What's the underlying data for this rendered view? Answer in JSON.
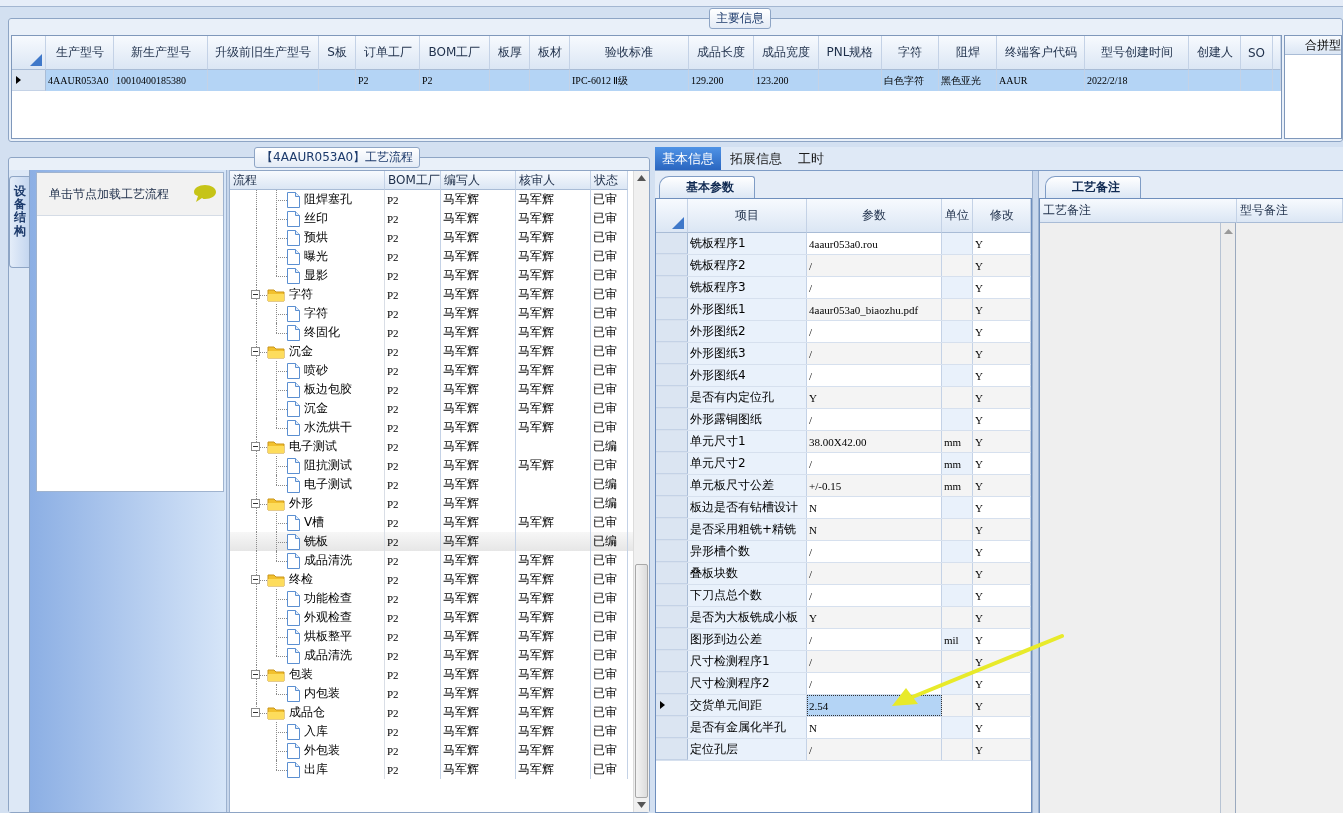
{
  "main_info": {
    "title": "主要信息",
    "columns": [
      "生产型号",
      "新生产型号",
      "升级前旧生产型号",
      "S板",
      "订单工厂",
      "BOM工厂",
      "板厚",
      "板材",
      "验收标准",
      "成品长度",
      "成品宽度",
      "PNL规格",
      "字符",
      "阻焊",
      "终端客户代码",
      "型号创建时间",
      "创建人",
      "SO"
    ],
    "rows": [
      {
        "selected": true,
        "cells": [
          "4AAUR053A0",
          "10010400185380",
          null,
          null,
          "P2",
          "P2",
          null,
          null,
          "IPC-6012 Ⅱ级",
          "129.200",
          "123.200",
          null,
          "白色字符",
          "黑色亚光",
          "AAUR",
          "2022/2/18",
          null,
          null
        ]
      }
    ],
    "side_header": "合拼型"
  },
  "process": {
    "title": "【4AAUR053A0】工艺流程",
    "side_tab": "设备结构",
    "hint": "单击节点加载工艺流程",
    "columns": [
      "流程",
      "BOM工厂",
      "编写人",
      "核审人",
      "状态"
    ],
    "tree": [
      {
        "children": [
          {
            "label": "阻焊塞孔",
            "bom": "P2",
            "writer": "马军辉",
            "reviewer": "马军辉",
            "status": "已审",
            "selected": false
          },
          {
            "label": "丝印",
            "bom": "P2",
            "writer": "马军辉",
            "reviewer": "马军辉",
            "status": "已审",
            "selected": false
          },
          {
            "label": "预烘",
            "bom": "P2",
            "writer": "马军辉",
            "reviewer": "马军辉",
            "status": "已审",
            "selected": false
          },
          {
            "label": "曝光",
            "bom": "P2",
            "writer": "马军辉",
            "reviewer": "马军辉",
            "status": "已审",
            "selected": false
          },
          {
            "label": "显影",
            "bom": "P2",
            "writer": "马军辉",
            "reviewer": "马军辉",
            "status": "已审",
            "selected": false
          }
        ]
      },
      {
        "label": "字符",
        "bom": "P2",
        "writer": "马军辉",
        "reviewer": "马军辉",
        "status": "已审",
        "selected": false,
        "expanded": true,
        "children": [
          {
            "label": "字符",
            "bom": "P2",
            "writer": "马军辉",
            "reviewer": "马军辉",
            "status": "已审",
            "selected": false
          },
          {
            "label": "终固化",
            "bom": "P2",
            "writer": "马军辉",
            "reviewer": "马军辉",
            "status": "已审",
            "selected": false
          }
        ]
      },
      {
        "label": "沉金",
        "bom": "P2",
        "writer": "马军辉",
        "reviewer": "马军辉",
        "status": "已审",
        "selected": false,
        "expanded": true,
        "children": [
          {
            "label": "喷砂",
            "bom": "P2",
            "writer": "马军辉",
            "reviewer": "马军辉",
            "status": "已审",
            "selected": false
          },
          {
            "label": "板边包胶",
            "bom": "P2",
            "writer": "马军辉",
            "reviewer": "马军辉",
            "status": "已审",
            "selected": false
          },
          {
            "label": "沉金",
            "bom": "P2",
            "writer": "马军辉",
            "reviewer": "马军辉",
            "status": "已审",
            "selected": false
          },
          {
            "label": "水洗烘干",
            "bom": "P2",
            "writer": "马军辉",
            "reviewer": "马军辉",
            "status": "已审",
            "selected": false
          }
        ]
      },
      {
        "label": "电子测试",
        "bom": "P2",
        "writer": "马军辉",
        "status": "已编",
        "selected": false,
        "expanded": true,
        "children": [
          {
            "label": "阻抗测试",
            "bom": "P2",
            "writer": "马军辉",
            "reviewer": "马军辉",
            "status": "已审",
            "selected": false
          },
          {
            "label": "电子测试",
            "bom": "P2",
            "writer": "马军辉",
            "status": "已编",
            "selected": false
          }
        ]
      },
      {
        "label": "外形",
        "bom": "P2",
        "writer": "马军辉",
        "status": "已编",
        "selected": false,
        "expanded": true,
        "children": [
          {
            "label": "V槽",
            "bom": "P2",
            "writer": "马军辉",
            "reviewer": "马军辉",
            "status": "已审",
            "selected": false
          },
          {
            "label": "铣板",
            "bom": "P2",
            "writer": "马军辉",
            "status": "已编",
            "selected": true
          },
          {
            "label": "成品清洗",
            "bom": "P2",
            "writer": "马军辉",
            "reviewer": "马军辉",
            "status": "已审",
            "selected": false
          }
        ]
      },
      {
        "label": "终检",
        "bom": "P2",
        "writer": "马军辉",
        "reviewer": "马军辉",
        "status": "已审",
        "selected": false,
        "expanded": true,
        "children": [
          {
            "label": "功能检查",
            "bom": "P2",
            "writer": "马军辉",
            "reviewer": "马军辉",
            "status": "已审",
            "selected": false
          },
          {
            "label": "外观检查",
            "bom": "P2",
            "writer": "马军辉",
            "reviewer": "马军辉",
            "status": "已审",
            "selected": false
          },
          {
            "label": "烘板整平",
            "bom": "P2",
            "writer": "马军辉",
            "reviewer": "马军辉",
            "status": "已审",
            "selected": false
          },
          {
            "label": "成品清洗",
            "bom": "P2",
            "writer": "马军辉",
            "reviewer": "马军辉",
            "status": "已审",
            "selected": false
          }
        ]
      },
      {
        "label": "包装",
        "bom": "P2",
        "writer": "马军辉",
        "reviewer": "马军辉",
        "status": "已审",
        "selected": false,
        "expanded": true,
        "children": [
          {
            "label": "内包装",
            "bom": "P2",
            "writer": "马军辉",
            "reviewer": "马军辉",
            "status": "已审",
            "selected": false
          }
        ]
      },
      {
        "label": "成品仓",
        "bom": "P2",
        "writer": "马军辉",
        "reviewer": "马军辉",
        "status": "已审",
        "selected": false,
        "expanded": true,
        "children": [
          {
            "label": "入库",
            "bom": "P2",
            "writer": "马军辉",
            "reviewer": "马军辉",
            "status": "已审",
            "selected": false
          },
          {
            "label": "外包装",
            "bom": "P2",
            "writer": "马军辉",
            "reviewer": "马军辉",
            "status": "已审",
            "selected": false
          },
          {
            "label": "出库",
            "bom": "P2",
            "writer": "马军辉",
            "reviewer": "马军辉",
            "status": "已审",
            "selected": false
          }
        ]
      }
    ]
  },
  "detail_tabs": [
    {
      "label": "基本信息",
      "selected": true
    },
    {
      "label": "拓展信息",
      "selected": false
    },
    {
      "label": "工时",
      "selected": false
    }
  ],
  "params": {
    "tab": "基本参数",
    "columns": [
      "项目",
      "参数",
      "单位",
      "修改"
    ],
    "rows": [
      {
        "item": "铣板程序1",
        "value": "4aaur053a0.rou",
        "modify": "Y",
        "selected": false
      },
      {
        "item": "铣板程序2",
        "value": "/",
        "modify": "Y",
        "selected": false
      },
      {
        "item": "铣板程序3",
        "value": "/",
        "modify": "Y",
        "selected": false
      },
      {
        "item": "外形图纸1",
        "value": "4aaur053a0_biaozhu.pdf",
        "modify": "Y",
        "selected": false
      },
      {
        "item": "外形图纸2",
        "value": "/",
        "modify": "Y",
        "selected": false
      },
      {
        "item": "外形图纸3",
        "value": "/",
        "modify": "Y",
        "selected": false
      },
      {
        "item": "外形图纸4",
        "value": "/",
        "modify": "Y",
        "selected": false
      },
      {
        "item": "是否有内定位孔",
        "value": "Y",
        "modify": "Y",
        "selected": false
      },
      {
        "item": "外形露铜图纸",
        "value": "/",
        "modify": "Y",
        "selected": false
      },
      {
        "item": "单元尺寸1",
        "value": "38.00X42.00",
        "unit": "mm",
        "modify": "Y",
        "selected": false
      },
      {
        "item": "单元尺寸2",
        "value": "/",
        "unit": "mm",
        "modify": "Y",
        "selected": false
      },
      {
        "item": "单元板尺寸公差",
        "value": "+/-0.15",
        "unit": "mm",
        "modify": "Y",
        "selected": false
      },
      {
        "item": "板边是否有钻槽设计",
        "value": "N",
        "modify": "Y",
        "selected": false
      },
      {
        "item": "是否采用粗铣+精铣",
        "value": "N",
        "modify": "Y",
        "selected": false
      },
      {
        "item": "异形槽个数",
        "value": "/",
        "modify": "Y",
        "selected": false
      },
      {
        "item": "叠板块数",
        "value": "/",
        "modify": "Y",
        "selected": false
      },
      {
        "item": "下刀点总个数",
        "value": "/",
        "modify": "Y",
        "selected": false
      },
      {
        "item": "是否为大板铣成小板",
        "value": "Y",
        "modify": "Y",
        "selected": false
      },
      {
        "item": "图形到边公差",
        "value": "/",
        "unit": "mil",
        "modify": "Y",
        "selected": false
      },
      {
        "item": "尺寸检测程序1",
        "value": "/",
        "modify": "Y",
        "selected": false
      },
      {
        "item": "尺寸检测程序2",
        "value": "/",
        "modify": "Y",
        "selected": false
      },
      {
        "item": "交货单元间距",
        "value": "2.54",
        "modify": "Y",
        "selected": true
      },
      {
        "item": "是否有金属化半孔",
        "value": "N",
        "modify": "Y",
        "selected": false
      },
      {
        "item": "定位孔层",
        "value": "/",
        "modify": "Y",
        "selected": false
      }
    ]
  },
  "notes": {
    "tab": "工艺备注",
    "columns": [
      "工艺备注",
      "型号备注"
    ]
  }
}
